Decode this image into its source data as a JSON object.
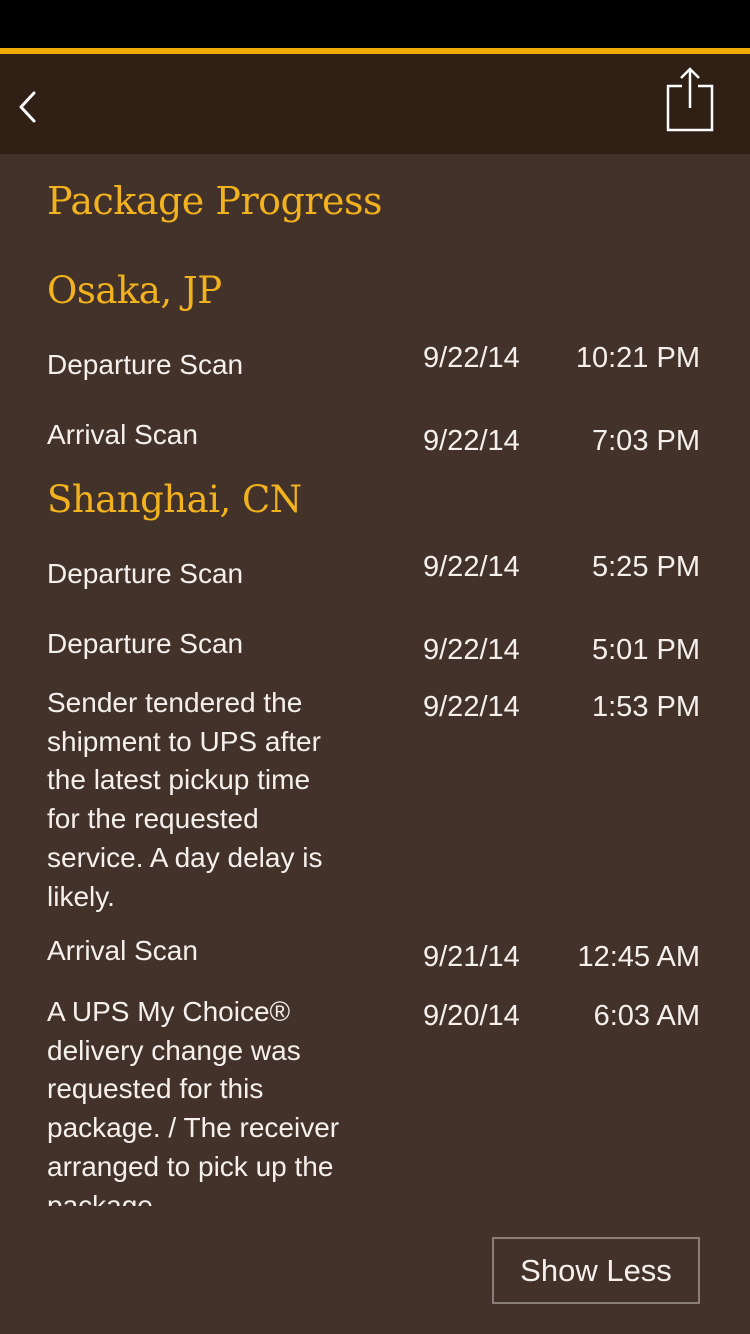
{
  "nav": {
    "back_icon": "chevron-left-icon",
    "share_icon": "share-icon"
  },
  "colors": {
    "status_bar": "#000000",
    "accent": "#f0ab00",
    "nav_background": "#2f1f14",
    "content_background": "#43322a",
    "heading_text": "#f2b21e",
    "body_text": "#f5f0ec"
  },
  "progress": {
    "title": "Package Progress",
    "locations": [
      {
        "name": "Osaka, JP",
        "events": [
          {
            "description": "Departure Scan",
            "date": "9/22/14",
            "time": "10:21 PM"
          },
          {
            "description": "Arrival Scan",
            "date": "9/22/14",
            "time": "7:03 PM"
          }
        ]
      },
      {
        "name": "Shanghai, CN",
        "events": [
          {
            "description": "Departure Scan",
            "date": "9/22/14",
            "time": "5:25 PM"
          },
          {
            "description": "Departure Scan",
            "date": "9/22/14",
            "time": "5:01 PM"
          },
          {
            "description": "Sender tendered the shipment to UPS after the latest pickup time for the requested service. A day delay is likely.",
            "date": "9/22/14",
            "time": "1:53 PM"
          },
          {
            "description": "Arrival Scan",
            "date": "9/21/14",
            "time": "12:45 AM"
          },
          {
            "description": "A UPS My Choice® delivery change was requested for this package. / The receiver arranged to pick up the package",
            "date": "9/20/14",
            "time": "6:03 AM"
          }
        ]
      }
    ]
  },
  "footer": {
    "show_less_label": "Show Less"
  }
}
